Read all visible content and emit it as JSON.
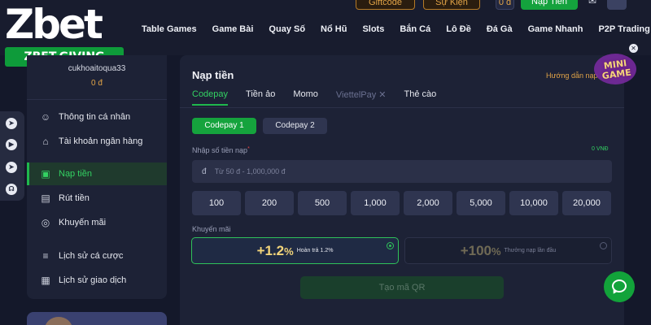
{
  "logo": {
    "text": "Zbet",
    "badge": "ZBET.GIVING"
  },
  "header": {
    "giftcode": "Giftcode",
    "su_kien": "Sự Kiện",
    "balance": "0 đ",
    "nap_tien": "Nạp Tiền",
    "nav": [
      "Table Games",
      "Game Bài",
      "Quay Số",
      "Nổ Hũ",
      "Slots",
      "Bắn Cá",
      "Lô Đề",
      "Đá Gà",
      "Game Nhanh",
      "P2P Trading"
    ]
  },
  "sidebar": {
    "username": "cukhoaitoqua33",
    "balance": "0 đ",
    "items": [
      {
        "label": "Thông tin cá nhân",
        "icon": "user-icon"
      },
      {
        "label": "Tài khoản ngân hàng",
        "icon": "bank-icon"
      },
      {
        "label": "Nạp tiền",
        "icon": "deposit-icon",
        "active": true
      },
      {
        "label": "Rút tiền",
        "icon": "withdraw-icon"
      },
      {
        "label": "Khuyến mãi",
        "icon": "promotion-icon"
      },
      {
        "label": "Lịch sử cá cược",
        "icon": "bet-history-icon"
      },
      {
        "label": "Lịch sử giao dịch",
        "icon": "transaction-history-icon"
      }
    ]
  },
  "panel": {
    "title": "Nạp tiền",
    "guide": "Hướng dẫn nạp",
    "tabs": [
      {
        "label": "Codepay",
        "state": "active"
      },
      {
        "label": "Tiền ảo",
        "state": "normal"
      },
      {
        "label": "Momo",
        "state": "normal"
      },
      {
        "label": "ViettelPay",
        "state": "disabled"
      },
      {
        "label": "Thẻ cào",
        "state": "normal"
      }
    ],
    "subtabs": [
      "Codepay 1",
      "Codepay 2"
    ],
    "amount_label": "Nhập số tiền nạp",
    "amount_right": "0 VNĐ",
    "currency": "đ",
    "amount_placeholder": "Từ 50 đ - 1,000,000 đ",
    "quick_amounts": [
      "100",
      "200",
      "500",
      "1,000",
      "2,000",
      "5,000",
      "10,000",
      "20,000"
    ],
    "promo_label": "Khuyến mãi",
    "promos": [
      {
        "big": "+1.2",
        "unit": "%",
        "small": "Hoàn trả 1.2%",
        "selected": true
      },
      {
        "big": "+100",
        "unit": "%",
        "small": "Thưởng nạp lần đầu",
        "selected": false
      }
    ],
    "qr_button": "Tạo mã QR"
  },
  "floating": {
    "mini_game": "MINI GAME"
  },
  "colors": {
    "accent": "#1fb84d",
    "gold": "#e2a447",
    "bg": "#14182a",
    "panel": "#1d2236"
  }
}
